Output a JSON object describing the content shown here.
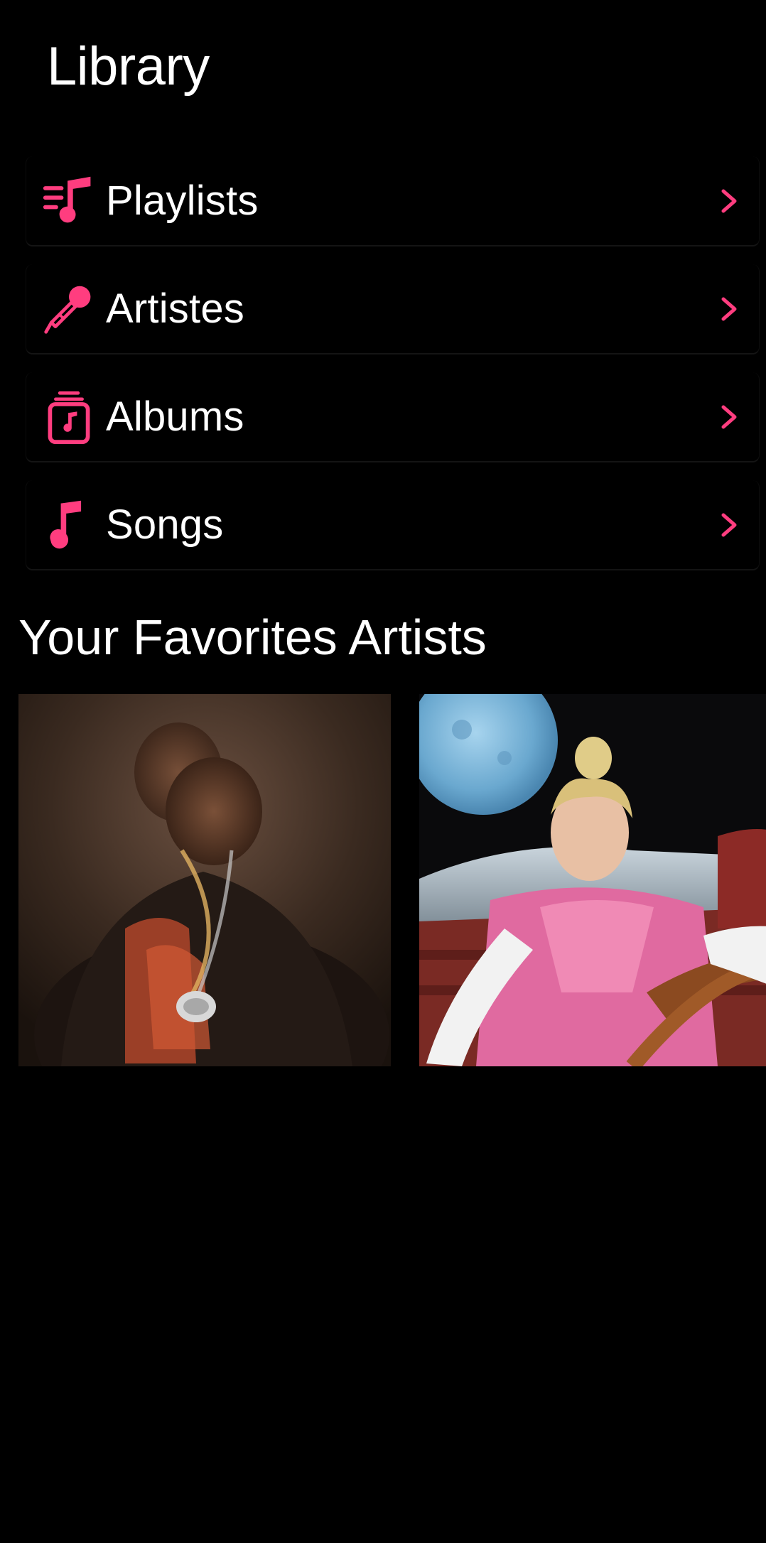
{
  "header": {
    "title": "Library"
  },
  "menu": {
    "items": [
      {
        "label": "Playlists",
        "icon": "playlist-music-icon"
      },
      {
        "label": "Artistes",
        "icon": "microphone-icon"
      },
      {
        "label": "Albums",
        "icon": "album-stack-icon"
      },
      {
        "label": "Songs",
        "icon": "music-note-icon"
      }
    ],
    "chevron_icon": "chevron-right-icon"
  },
  "favorites": {
    "title": "Your Favorites Artists",
    "artists": [
      {
        "image": "artist-photo-blurred-portrait"
      },
      {
        "image": "artist-photo-pink-shirt-moon"
      }
    ]
  },
  "colors": {
    "background": "#000000",
    "accent": "#ff3d7f",
    "text": "#ffffff"
  }
}
